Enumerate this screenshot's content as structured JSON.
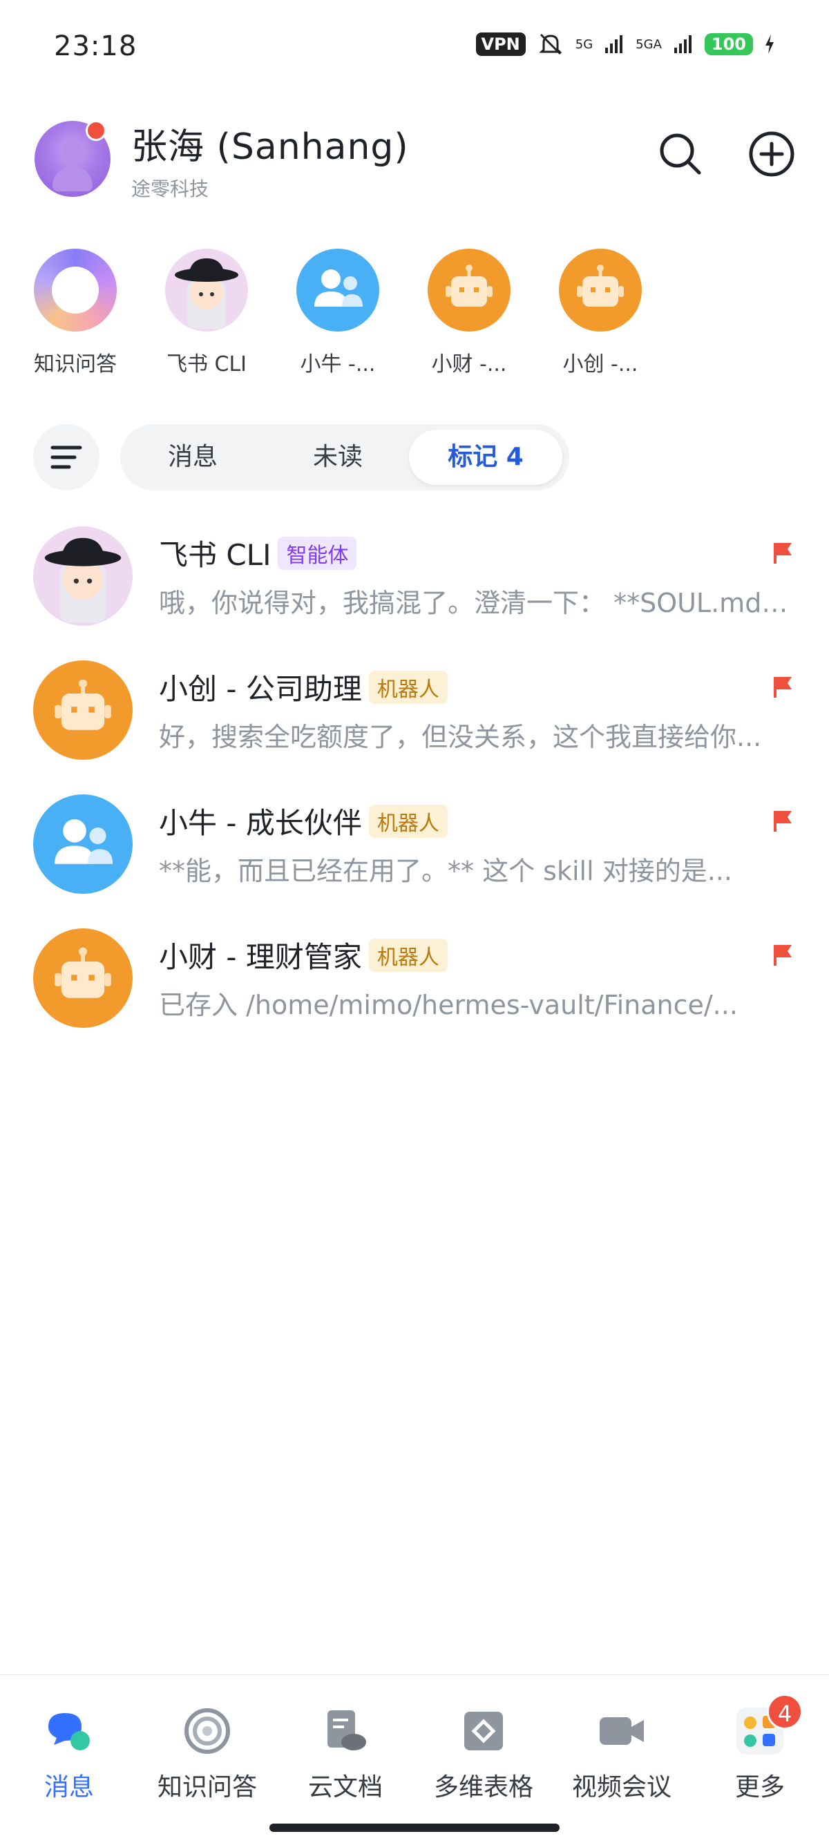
{
  "status_bar": {
    "time": "23:18",
    "vpn": "VPN",
    "signal_1": "5G",
    "signal_2": "5GA",
    "battery": "100"
  },
  "header": {
    "user_name": "张海 (Sanhang)",
    "org_name": "途零科技"
  },
  "shortcuts": [
    {
      "label": "知识问答",
      "icon": "knowledge-ring"
    },
    {
      "label": "飞书 CLI",
      "icon": "girl-avatar"
    },
    {
      "label": "小牛 -...",
      "icon": "group-users"
    },
    {
      "label": "小财 -...",
      "icon": "robot"
    },
    {
      "label": "小创 -...",
      "icon": "robot"
    }
  ],
  "filter": {
    "tabs": [
      "消息",
      "未读",
      "标记 4"
    ],
    "active": "标记 4"
  },
  "chats": [
    {
      "name": "飞书 CLI",
      "badge": "智能体",
      "badge_type": "agent",
      "preview": "哦，你说得对，我搞混了。澄清一下：  **SOUL.md** 是...",
      "avatar": "girl-avatar",
      "flagged": true
    },
    {
      "name": "小创 - 公司助理",
      "badge": "机器人",
      "badge_type": "bot",
      "preview": "好，搜索全吃额度了，但没关系，这个我直接给你...",
      "avatar": "robot",
      "flagged": true
    },
    {
      "name": "小牛 - 成长伙伴",
      "badge": "机器人",
      "badge_type": "bot",
      "preview": "**能，而且已经在用了。**  这个 skill 对接的是...",
      "avatar": "group-users",
      "flagged": true
    },
    {
      "name": "小财 - 理财管家",
      "badge": "机器人",
      "badge_type": "bot",
      "preview": "已存入 /home/mimo/hermes-vault/Finance/...",
      "avatar": "robot",
      "flagged": true
    }
  ],
  "bottom_nav": {
    "tabs": [
      "消息",
      "知识问答",
      "云文档",
      "多维表格",
      "视频会议",
      "更多"
    ],
    "active": "消息",
    "more_badge": "4"
  },
  "colors": {
    "accent": "#3370ff",
    "flag": "#f04f3d",
    "robot_orange": "#f39a2c",
    "group_blue": "#4ab0f5"
  }
}
